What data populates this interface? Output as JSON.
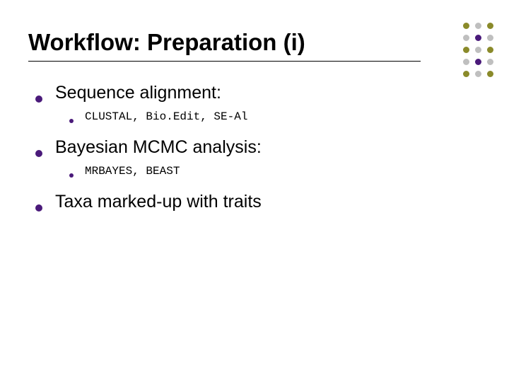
{
  "title": "Workflow: Preparation (i)",
  "items": [
    {
      "label": "Sequence alignment:",
      "sub": "CLUSTAL, Bio.Edit, SE-Al"
    },
    {
      "label": "Bayesian MCMC analysis:",
      "sub": "MRBAYES, BEAST"
    },
    {
      "label": "Taxa marked-up with traits",
      "sub": null
    }
  ],
  "deco_colors": {
    "olive": "#8a8a2a",
    "grey": "#bfbfbf",
    "purple": "#4a1a7a"
  }
}
